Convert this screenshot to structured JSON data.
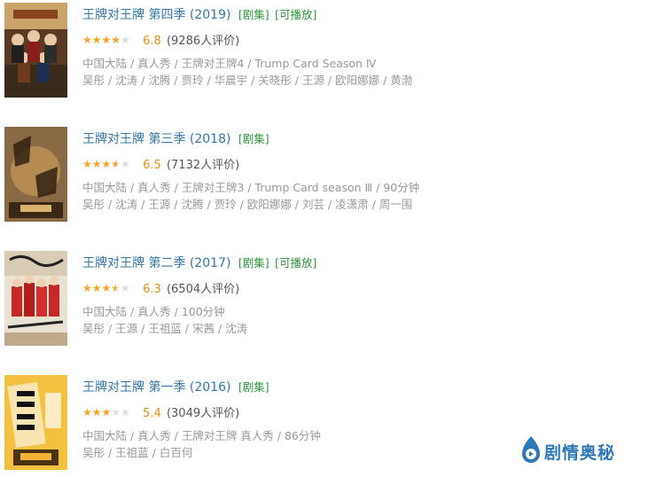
{
  "items": [
    {
      "title": "王牌对王牌 第四季 (2019)",
      "tags": [
        "[剧集]",
        "[可播放]"
      ],
      "rating_fraction": 0.68,
      "score": "6.8",
      "count": "(9286人评价)",
      "meta1": "中国大陆 / 真人秀 / 王牌对王牌4 / Trump Card Season Ⅳ",
      "meta2": "吴彤 / 沈涛 / 沈腾 / 贾玲 / 华晨宇 / 关晓彤 / 王源 / 欧阳娜娜 / 黄渤"
    },
    {
      "title": "王牌对王牌 第三季 (2018)",
      "tags": [
        "[剧集]"
      ],
      "rating_fraction": 0.65,
      "score": "6.5",
      "count": "(7132人评价)",
      "meta1": "中国大陆 / 真人秀 / 王牌对王牌3 / Trump Card season Ⅲ / 90分钟",
      "meta2": "吴彤 / 沈涛 / 王源 / 沈腾 / 贾玲 / 欧阳娜娜 / 刘芸 / 凌潇肃 / 周一围"
    },
    {
      "title": "王牌对王牌 第二季 (2017)",
      "tags": [
        "[剧集]",
        "[可播放]"
      ],
      "rating_fraction": 0.63,
      "score": "6.3",
      "count": "(6504人评价)",
      "meta1": "中国大陆 / 真人秀 / 100分钟",
      "meta2": "吴彤 / 王源 / 王祖蓝 / 宋茜 / 沈涛"
    },
    {
      "title": "王牌对王牌 第一季 (2016)",
      "tags": [
        "[剧集]"
      ],
      "rating_fraction": 0.54,
      "score": "5.4",
      "count": "(3049人评价)",
      "meta1": "中国大陆 / 真人秀 / 王牌对王牌 真人秀 / 86分钟",
      "meta2": "吴彤 / 王祖蓝 / 白百何"
    }
  ],
  "logo_text": "剧情奥秘",
  "colors": {
    "title": "#3377aa",
    "tag": "#2e963d",
    "star": "#f5a623",
    "score": "#e09015",
    "meta": "#999999",
    "logo": "#2f78b8"
  }
}
